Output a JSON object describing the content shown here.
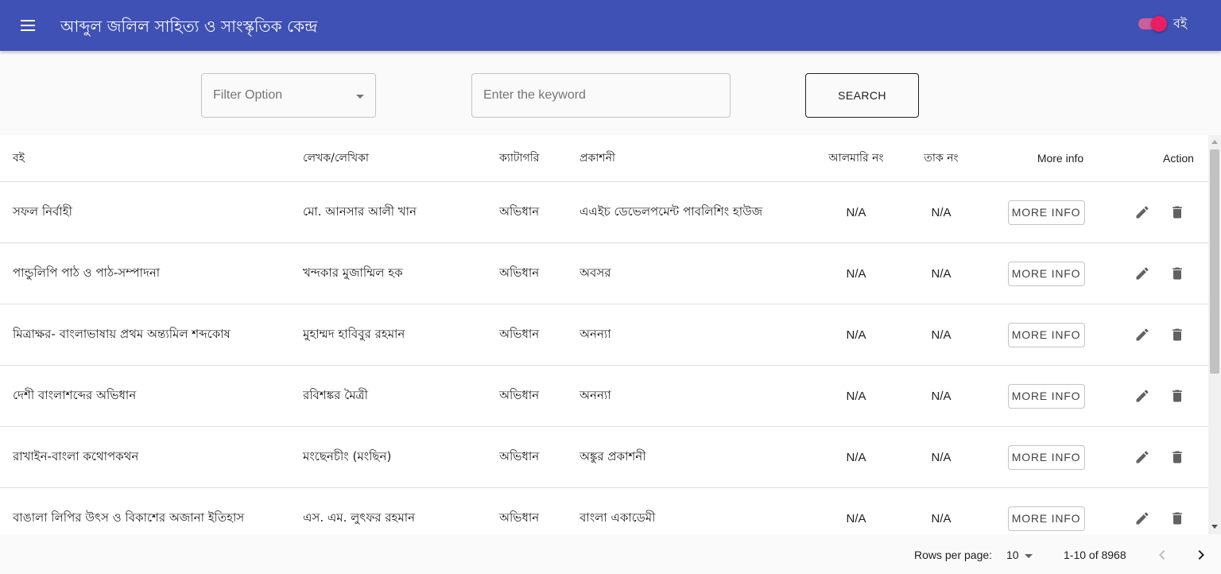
{
  "header": {
    "title": "আব্দুল জলিল সাহিত্য ও সাংস্কৃতিক কেন্দ্র",
    "toggle_label": "বই",
    "toggle_on": true,
    "bar_color": "#3f51b5",
    "toggle_color": "#e91e63",
    "menu_icon": "menu-icon"
  },
  "search": {
    "filter_placeholder": "Filter Option",
    "keyword_placeholder": "Enter the keyword",
    "search_label": "SEARCH"
  },
  "table": {
    "columns": [
      "বই",
      "লেখক/লেখিকা",
      "ক্যাটাগরি",
      "প্রকাশনী",
      "আলমারি নং",
      "তাক নং",
      "More info",
      "Action"
    ],
    "more_info_label": "MORE INFO",
    "action_icons": [
      "edit-icon",
      "delete-icon"
    ],
    "rows": [
      {
        "book": "সফল নির্বাহী",
        "author": "মো. আনসার আলী খান",
        "category": "অভিধান",
        "publisher": "এএইচ ডেভেলপমেন্ট পাবলিশিং হাউজ",
        "shelf": "N/A",
        "rack": "N/A"
      },
      {
        "book": "পান্ডুলিপি পাঠ ও পাঠ-সম্পাদনা",
        "author": "খন্দকার মুজাম্মিল হক",
        "category": "অভিধান",
        "publisher": "অবসর",
        "shelf": "N/A",
        "rack": "N/A"
      },
      {
        "book": "মিত্রাক্ষর- বাংলাভাষায় প্রথম অন্ত্যমিল শব্দকোষ",
        "author": "মুহাম্মদ হাবিবুর রহমান",
        "category": "অভিধান",
        "publisher": "অনন্যা",
        "shelf": "N/A",
        "rack": "N/A"
      },
      {
        "book": "দেশী বাংলাশব্দের অভিধান",
        "author": "রবিশঙ্কর মৈত্রী",
        "category": "অভিধান",
        "publisher": "অনন্যা",
        "shelf": "N/A",
        "rack": "N/A"
      },
      {
        "book": "রাখাইন-বাংলা কথোপকথন",
        "author": "মংছেনচীং (মংছিন)",
        "category": "অভিধান",
        "publisher": "অঙ্কুর প্রকাশনী",
        "shelf": "N/A",
        "rack": "N/A"
      },
      {
        "book": "বাঙালা লিপির উৎস ও বিকাশের অজানা ইতিহাস",
        "author": "এস. এম. লুৎফর রহমান",
        "category": "অভিধান",
        "publisher": "বাংলা একাডেমী",
        "shelf": "N/A",
        "rack": "N/A"
      }
    ]
  },
  "pagination": {
    "rows_per_page_label": "Rows per page:",
    "rows_per_page_value": "10",
    "range_label": "1-10 of 8968"
  }
}
